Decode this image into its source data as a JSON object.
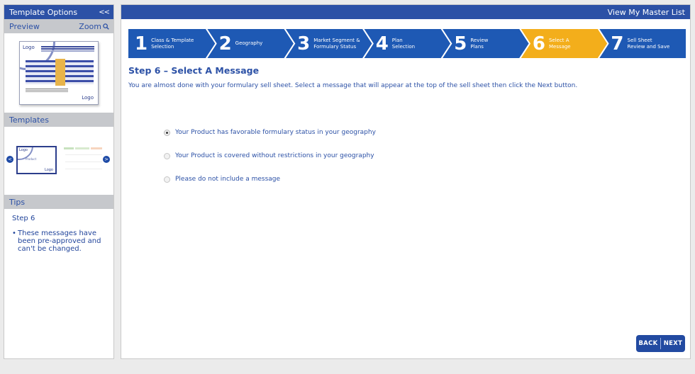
{
  "sidebar": {
    "title": "Template Options",
    "collapse_label": "<<",
    "preview": {
      "label": "Preview",
      "zoom_label": "Zoom",
      "thumb_logo_top": "Logo",
      "thumb_logo_bottom": "Logo"
    },
    "templates": {
      "label": "Templates",
      "prev_glyph": "<",
      "next_glyph": ">",
      "template_a": {
        "logo_top": "Logo",
        "logo_bottom": "Logo",
        "mid_text": "Product"
      }
    },
    "tips": {
      "label": "Tips",
      "step": "Step 6",
      "bullet": "•",
      "text": "These messages have been pre-approved and can't be changed."
    }
  },
  "header": {
    "master_list_link": "View My Master List"
  },
  "steps": [
    {
      "num": "1",
      "line1": "Class & Template",
      "line2": "Selection",
      "active": false
    },
    {
      "num": "2",
      "line1": "Geography",
      "line2": "",
      "active": false
    },
    {
      "num": "3",
      "line1": "Market Segment &",
      "line2": "Formulary Status",
      "active": false
    },
    {
      "num": "4",
      "line1": "Plan",
      "line2": "Selection",
      "active": false
    },
    {
      "num": "5",
      "line1": "Review",
      "line2": "Plans",
      "active": false
    },
    {
      "num": "6",
      "line1": "Select A",
      "line2": "Message",
      "active": true
    },
    {
      "num": "7",
      "line1": "Sell Sheet",
      "line2": "Review and Save",
      "active": false
    }
  ],
  "colors": {
    "brand": "#2c51a6",
    "step_blue": "#1e59b4",
    "step_active": "#f3ae1b"
  },
  "main": {
    "title": "Step 6 – Select A Message",
    "instructions": "You are almost done with your formulary sell sheet.  Select a message that will appear at the top of the sell sheet then click the Next button.",
    "options": [
      {
        "label": "Your Product has favorable formulary status in your geography",
        "selected": true
      },
      {
        "label": "Your Product is covered without restrictions in your geography",
        "selected": false
      },
      {
        "label": "Please do not include a message",
        "selected": false
      }
    ],
    "back_label": "BACK",
    "next_label": "NEXT"
  }
}
